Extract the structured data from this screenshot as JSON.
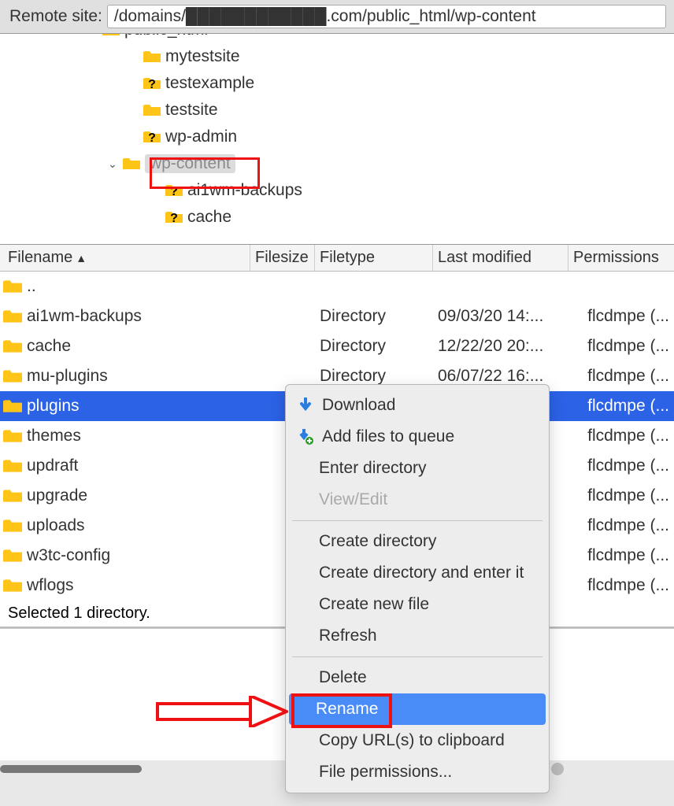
{
  "remote": {
    "label": "Remote site:",
    "path": "/domains/████████████.com/public_html/wp-content"
  },
  "tree": {
    "items": [
      {
        "indent": 108,
        "toggle": " ",
        "icon": "folder",
        "label": "public_html"
      },
      {
        "indent": 160,
        "toggle": "",
        "icon": "folder",
        "label": "mytestsite"
      },
      {
        "indent": 160,
        "toggle": "",
        "icon": "question",
        "label": "testexample"
      },
      {
        "indent": 160,
        "toggle": "",
        "icon": "folder",
        "label": "testsite"
      },
      {
        "indent": 160,
        "toggle": "",
        "icon": "question",
        "label": "wp-admin"
      },
      {
        "indent": 134,
        "toggle": "⌄",
        "icon": "folder",
        "label": "wp-content",
        "selected": true
      },
      {
        "indent": 188,
        "toggle": "",
        "icon": "question",
        "label": "ai1wm-backups"
      },
      {
        "indent": 188,
        "toggle": "",
        "icon": "question",
        "label": "cache"
      }
    ]
  },
  "list": {
    "headers": {
      "name": "Filename",
      "size": "Filesize",
      "type": "Filetype",
      "modified": "Last modified",
      "perm": "Permissions"
    },
    "rows": [
      {
        "name": "..",
        "size": "",
        "type": "",
        "modified": "",
        "perm": ""
      },
      {
        "name": "ai1wm-backups",
        "size": "",
        "type": "Directory",
        "modified": "09/03/20 14:...",
        "perm": "flcdmpe (..."
      },
      {
        "name": "cache",
        "size": "",
        "type": "Directory",
        "modified": "12/22/20 20:...",
        "perm": "flcdmpe (..."
      },
      {
        "name": "mu-plugins",
        "size": "",
        "type": "Directory",
        "modified": "06/07/22 16:...",
        "perm": "flcdmpe (..."
      },
      {
        "name": "plugins",
        "size": "",
        "type": "",
        "modified": "",
        "perm": "flcdmpe (...",
        "selected": true
      },
      {
        "name": "themes",
        "size": "",
        "type": "",
        "modified": "",
        "perm": "flcdmpe (..."
      },
      {
        "name": "updraft",
        "size": "",
        "type": "",
        "modified": "",
        "perm": "flcdmpe (..."
      },
      {
        "name": "upgrade",
        "size": "",
        "type": "",
        "modified": "",
        "perm": "flcdmpe (..."
      },
      {
        "name": "uploads",
        "size": "",
        "type": "",
        "modified": "",
        "perm": "flcdmpe (..."
      },
      {
        "name": "w3tc-config",
        "size": "",
        "type": "",
        "modified": "",
        "perm": "flcdmpe (..."
      },
      {
        "name": "wflogs",
        "size": "",
        "type": "",
        "modified": "",
        "perm": "flcdmpe (..."
      }
    ],
    "status": "Selected 1 directory."
  },
  "menu": {
    "download": "Download",
    "add_queue": "Add files to queue",
    "enter": "Enter directory",
    "viewedit": "View/Edit",
    "create_dir": "Create directory",
    "create_enter": "Create directory and enter it",
    "create_file": "Create new file",
    "refresh": "Refresh",
    "delete": "Delete",
    "rename": "Rename",
    "copyurl": "Copy URL(s) to clipboard",
    "fileperm": "File permissions..."
  }
}
